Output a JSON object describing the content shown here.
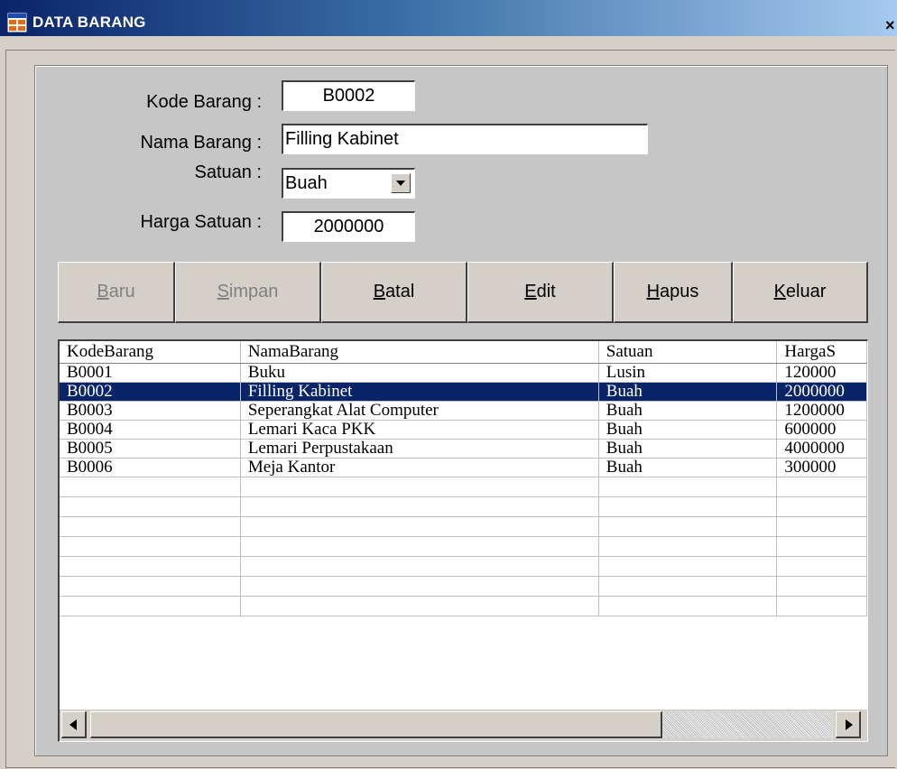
{
  "window": {
    "title": "DATA BARANG",
    "close_glyph": "×",
    "icon": "form-window-icon"
  },
  "form": {
    "kode_label": "Kode Barang :",
    "kode_value": "B0002",
    "nama_label": "Nama Barang :",
    "nama_value": "Filling Kabinet",
    "satuan_label": "Satuan :",
    "satuan_value": "Buah",
    "harga_label": "Harga Satuan :",
    "harga_value": "2000000"
  },
  "buttons": {
    "baru": {
      "mnemonic": "B",
      "rest": "aru",
      "enabled": false
    },
    "simpan": {
      "mnemonic": "S",
      "rest": "impan",
      "enabled": false
    },
    "batal": {
      "mnemonic": "B",
      "rest": "atal",
      "enabled": true
    },
    "edit": {
      "mnemonic": "E",
      "rest": "dit",
      "enabled": true
    },
    "hapus": {
      "mnemonic": "H",
      "rest": "apus",
      "enabled": true
    },
    "keluar": {
      "mnemonic": "K",
      "rest": "eluar",
      "enabled": true
    }
  },
  "grid": {
    "columns": [
      "KodeBarang",
      "NamaBarang",
      "Satuan",
      "HargaS"
    ],
    "rows": [
      [
        "B0001",
        "Buku",
        "Lusin",
        "120000"
      ],
      [
        "B0002",
        "Filling Kabinet",
        "Buah",
        "2000000"
      ],
      [
        "B0003",
        "Seperangkat Alat Computer",
        "Buah",
        "1200000"
      ],
      [
        "B0004",
        "Lemari Kaca PKK",
        "Buah",
        "600000"
      ],
      [
        "B0005",
        "Lemari Perpustakaan",
        "Buah",
        "4000000"
      ],
      [
        "B0006",
        "Meja Kantor",
        "Buah",
        "300000"
      ]
    ],
    "selected_row": 1
  },
  "colors": {
    "selection": "#0a246a",
    "titlebar_start": "#0a246a",
    "titlebar_end": "#a6caf0",
    "face": "#d4d0c8"
  }
}
